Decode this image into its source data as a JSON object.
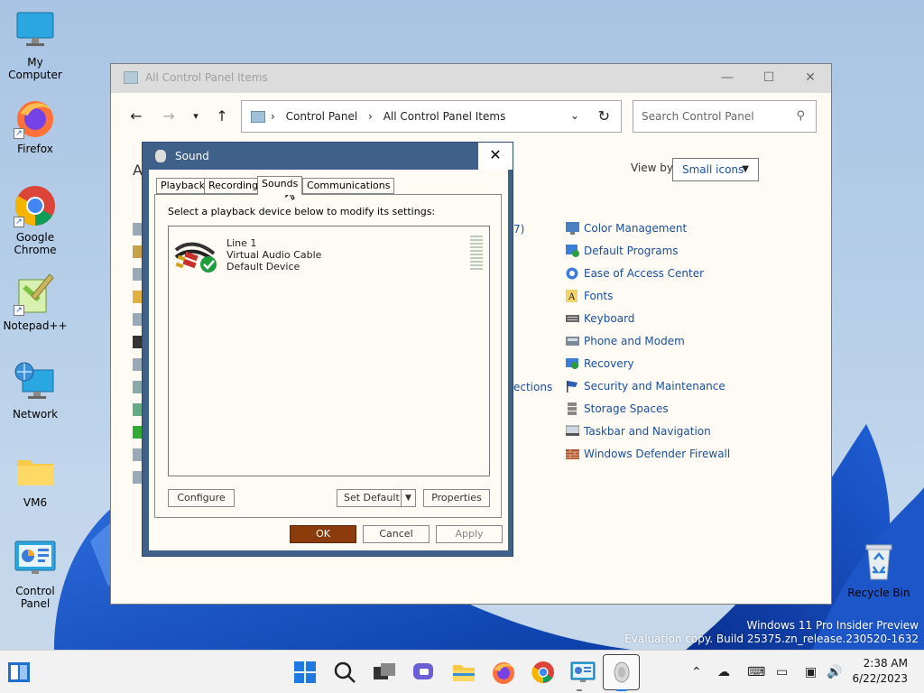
{
  "desktop": {
    "icons": [
      {
        "label": "My Computer",
        "icon": "monitor-icon"
      },
      {
        "label": "Firefox",
        "icon": "firefox-icon"
      },
      {
        "label": "Google Chrome",
        "icon": "chrome-icon"
      },
      {
        "label": "Notepad++",
        "icon": "notepadpp-icon"
      },
      {
        "label": "Network",
        "icon": "network-icon"
      },
      {
        "label": "VM6",
        "icon": "folder-icon"
      },
      {
        "label": "Control Panel",
        "icon": "control-panel-icon"
      }
    ],
    "recycle_bin": "Recycle Bin",
    "watermark": {
      "line1": "Windows 11 Pro Insider Preview",
      "line2": "Evaluation copy. Build 25375.zn_release.230520-1632"
    }
  },
  "control_panel": {
    "title": "All Control Panel Items",
    "breadcrumb": [
      "Control Panel",
      "All Control Panel Items"
    ],
    "search_placeholder": "Search Control Panel",
    "heading_partial": "A",
    "view_by_label": "View by:",
    "view_by_value": "Small icons",
    "partial_items": [
      "7)",
      "ections"
    ],
    "items": [
      {
        "label": "Color Management",
        "icon": "color-management-icon"
      },
      {
        "label": "Default Programs",
        "icon": "default-programs-icon"
      },
      {
        "label": "Ease of Access Center",
        "icon": "ease-of-access-icon"
      },
      {
        "label": "Fonts",
        "icon": "fonts-icon"
      },
      {
        "label": "Keyboard",
        "icon": "keyboard-icon"
      },
      {
        "label": "Phone and Modem",
        "icon": "phone-modem-icon"
      },
      {
        "label": "Recovery",
        "icon": "recovery-icon"
      },
      {
        "label": "Security and Maintenance",
        "icon": "security-flag-icon"
      },
      {
        "label": "Storage Spaces",
        "icon": "storage-spaces-icon"
      },
      {
        "label": "Taskbar and Navigation",
        "icon": "taskbar-nav-icon"
      },
      {
        "label": "Windows Defender Firewall",
        "icon": "firewall-icon"
      }
    ]
  },
  "sound_dialog": {
    "title": "Sound",
    "tabs": [
      "Playback",
      "Recording",
      "Sounds",
      "Communications"
    ],
    "active_tab": "Sounds",
    "instruction": "Select a playback device below to modify its settings:",
    "device": {
      "name": "Line 1",
      "description": "Virtual Audio Cable",
      "status": "Default Device"
    },
    "buttons": {
      "configure": "Configure",
      "set_default": "Set Default",
      "properties": "Properties",
      "ok": "OK",
      "cancel": "Cancel",
      "apply": "Apply"
    }
  },
  "taskbar": {
    "time": "2:38 AM",
    "date": "6/22/2023"
  },
  "colors": {
    "dialog_frame": "#3f6089",
    "link": "#1a4f9e",
    "ok_button": "#8c3b0d"
  }
}
